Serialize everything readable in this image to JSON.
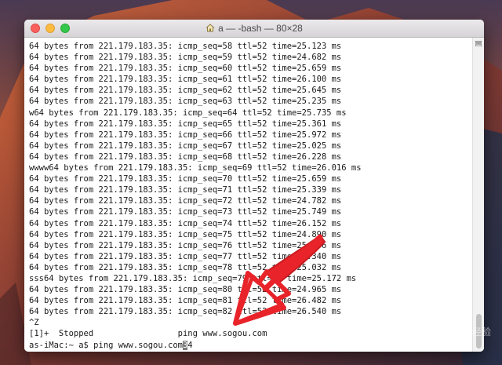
{
  "window": {
    "title": "a — -bash — 80×28"
  },
  "terminal": {
    "lines": [
      "64 bytes from 221.179.183.35: icmp_seq=58 ttl=52 time=25.123 ms",
      "64 bytes from 221.179.183.35: icmp_seq=59 ttl=52 time=24.682 ms",
      "64 bytes from 221.179.183.35: icmp_seq=60 ttl=52 time=25.659 ms",
      "64 bytes from 221.179.183.35: icmp_seq=61 ttl=52 time=26.100 ms",
      "64 bytes from 221.179.183.35: icmp_seq=62 ttl=52 time=25.645 ms",
      "64 bytes from 221.179.183.35: icmp_seq=63 ttl=52 time=25.235 ms",
      "w64 bytes from 221.179.183.35: icmp_seq=64 ttl=52 time=25.735 ms",
      "64 bytes from 221.179.183.35: icmp_seq=65 ttl=52 time=25.361 ms",
      "64 bytes from 221.179.183.35: icmp_seq=66 ttl=52 time=25.972 ms",
      "64 bytes from 221.179.183.35: icmp_seq=67 ttl=52 time=25.025 ms",
      "64 bytes from 221.179.183.35: icmp_seq=68 ttl=52 time=26.228 ms",
      "wwww64 bytes from 221.179.183.35: icmp_seq=69 ttl=52 time=26.016 ms",
      "64 bytes from 221.179.183.35: icmp_seq=70 ttl=52 time=25.659 ms",
      "64 bytes from 221.179.183.35: icmp_seq=71 ttl=52 time=25.339 ms",
      "64 bytes from 221.179.183.35: icmp_seq=72 ttl=52 time=24.782 ms",
      "64 bytes from 221.179.183.35: icmp_seq=73 ttl=52 time=25.749 ms",
      "64 bytes from 221.179.183.35: icmp_seq=74 ttl=52 time=26.152 ms",
      "64 bytes from 221.179.183.35: icmp_seq=75 ttl=52 time=24.890 ms",
      "64 bytes from 221.179.183.35: icmp_seq=76 ttl=52 time=25.566 ms",
      "64 bytes from 221.179.183.35: icmp_seq=77 ttl=52 time=25.340 ms",
      "64 bytes from 221.179.183.35: icmp_seq=78 ttl=52 time=25.032 ms",
      "sss64 bytes from 221.179.183.35: icmp_seq=79 ttl=52 time=25.172 ms",
      "64 bytes from 221.179.183.35: icmp_seq=80 ttl=52 time=24.965 ms",
      "64 bytes from 221.179.183.35: icmp_seq=81 ttl=52 time=26.482 ms",
      "64 bytes from 221.179.183.35: icmp_seq=82 ttl=52 time=26.540 ms",
      "^Z",
      "[1]+  Stopped                 ping www.sogou.com"
    ],
    "prompt_line": "as-iMac:~ a$ ping www.sogou.com",
    "cursor_char": "3",
    "after_cursor": "4"
  },
  "watermark": "优质经验",
  "colors": {
    "annotation_arrow": "#e8242a"
  }
}
